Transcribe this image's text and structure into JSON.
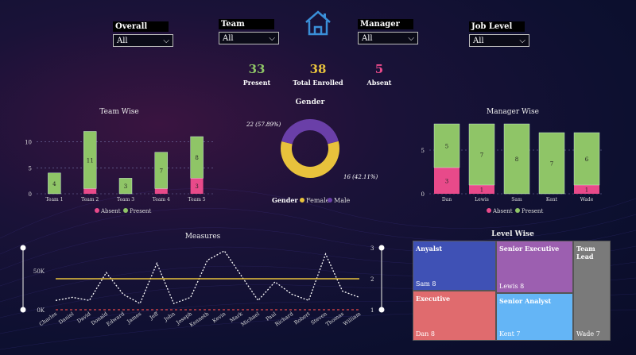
{
  "slicers": [
    {
      "title": "Overall",
      "value": "All"
    },
    {
      "title": "Team",
      "value": "All"
    },
    {
      "title": "Manager",
      "value": "All"
    },
    {
      "title": "Job Level",
      "value": "All"
    }
  ],
  "kpis": [
    {
      "value": "33",
      "label": "Present",
      "color": "#8fc567"
    },
    {
      "value": "38",
      "label": "Total Enrolled",
      "color": "#e8c23c"
    },
    {
      "value": "5",
      "label": "Absent",
      "color": "#e84a8a"
    }
  ],
  "colors": {
    "absent": "#e84a8a",
    "present": "#8fc567",
    "female": "#e8c23c",
    "male": "#6a3fa8"
  },
  "legend": {
    "absent": "Absent",
    "present": "Present",
    "gender_title": "Gender",
    "female": "Female",
    "male": "Male"
  },
  "home_icon": "home-icon",
  "chart_data": [
    {
      "type": "bar",
      "title": "Team Wise",
      "categories": [
        "Team 1",
        "Team 2",
        "Team 3",
        "Team 4",
        "Team 5"
      ],
      "series": [
        {
          "name": "Absent",
          "values": [
            0,
            1,
            0,
            1,
            3
          ]
        },
        {
          "name": "Present",
          "values": [
            4,
            11,
            3,
            7,
            8
          ]
        }
      ],
      "ylim": [
        0,
        11
      ],
      "yticks": [
        0,
        5,
        10
      ],
      "data_labels": [
        [
          "",
          "",
          "",
          "",
          "3"
        ],
        [
          "4",
          "11",
          "3",
          "7",
          "8"
        ]
      ]
    },
    {
      "type": "pie",
      "title": "Gender",
      "categories": [
        "Female",
        "Male"
      ],
      "values": [
        22,
        16
      ],
      "labels": [
        "22 (57.89%)",
        "16 (42.11%)"
      ]
    },
    {
      "type": "bar",
      "title": "Manager Wise",
      "categories": [
        "Dan",
        "Lewis",
        "Sam",
        "Kent",
        "Wade"
      ],
      "series": [
        {
          "name": "Absent",
          "values": [
            3,
            1,
            0,
            0,
            1
          ]
        },
        {
          "name": "Present",
          "values": [
            5,
            7,
            8,
            7,
            6
          ]
        }
      ],
      "ylim": [
        0,
        8
      ],
      "yticks": [
        0,
        5
      ],
      "data_labels": [
        [
          "3",
          "1",
          "",
          "",
          "1"
        ],
        [
          "5",
          "7",
          "8",
          "7",
          "6"
        ]
      ]
    },
    {
      "type": "line",
      "title": "Measures",
      "categories": [
        "Charles",
        "Daniel",
        "David",
        "Donald",
        "Edward",
        "James",
        "Jeff",
        "John",
        "Joseph",
        "Kenneth",
        "Kevin",
        "Mark",
        "Michael",
        "Paul",
        "Richard",
        "Robert",
        "Steven",
        "Thomas",
        "William"
      ],
      "series": [
        {
          "name": "dotted",
          "values": [
            1.3,
            1.4,
            1.3,
            2.2,
            1.5,
            1.2,
            2.5,
            1.2,
            1.4,
            2.6,
            2.9,
            2.1,
            1.3,
            1.9,
            1.5,
            1.3,
            2.8,
            1.6,
            1.4
          ]
        },
        {
          "name": "yellow",
          "values": [
            2,
            2,
            2,
            2,
            2,
            2,
            2,
            2,
            2,
            2,
            2,
            2,
            2,
            2,
            2,
            2,
            2,
            2,
            2
          ]
        },
        {
          "name": "red",
          "values": [
            1,
            1,
            1,
            1,
            1,
            1,
            1,
            1,
            1,
            1,
            1,
            1,
            1,
            1,
            1,
            1,
            1,
            1,
            1
          ]
        }
      ],
      "yleft_ticks": [
        "0K",
        "50K"
      ],
      "yright_ticks": [
        "1",
        "2",
        "3"
      ],
      "ylim": [
        1,
        3
      ]
    },
    {
      "type": "treemap",
      "title": "Level Wise",
      "items": [
        {
          "name": "Anyalst",
          "sub": "Sam 8",
          "color": "#3f51b5"
        },
        {
          "name": "Senior Executive",
          "sub": "Lewis 8",
          "color": "#9c5fb0"
        },
        {
          "name": "Team Lead",
          "sub": "Wade 7",
          "color": "#7a7a7a"
        },
        {
          "name": "Executive",
          "sub": "Dan 8",
          "color": "#e06b6e"
        },
        {
          "name": "Senior Analyst",
          "sub": "Kent 7",
          "color": "#64b5f6"
        }
      ]
    }
  ]
}
